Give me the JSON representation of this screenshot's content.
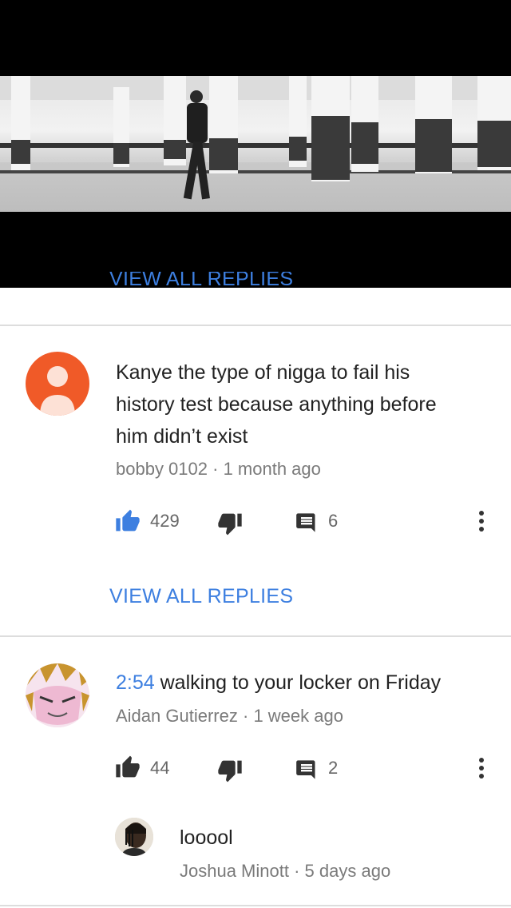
{
  "video": {
    "partial_label": "VIEW ALL REPLIES"
  },
  "comments": [
    {
      "text": "Kanye the type of nigga to fail his history test because anything before him didn’t exist",
      "text_lines": [
        "Kanye the type of nigga to fail his",
        "history test because anything before",
        "him didn’t exist"
      ],
      "author": "bobby 0102",
      "separator": "·",
      "time": "1 month ago",
      "likes": "429",
      "replies": "6",
      "liked": true,
      "view_replies": "VIEW ALL REPLIES"
    },
    {
      "timestamp": "2:54",
      "text": "walking to your locker on Friday",
      "author": "Aidan Gutierrez",
      "separator": "·",
      "time": "1 week ago",
      "likes": "44",
      "replies": "2",
      "liked": false,
      "reply": {
        "text": "looool",
        "author": "Joshua Minott",
        "separator": "·",
        "time": "5 days ago"
      }
    }
  ],
  "colors": {
    "accent": "#3d7fe0",
    "default_avatar": "#f05a28",
    "divider": "#dddddd"
  },
  "icons": [
    "thumb-up-icon",
    "thumb-down-icon",
    "reply-icon",
    "more-vert-icon"
  ]
}
